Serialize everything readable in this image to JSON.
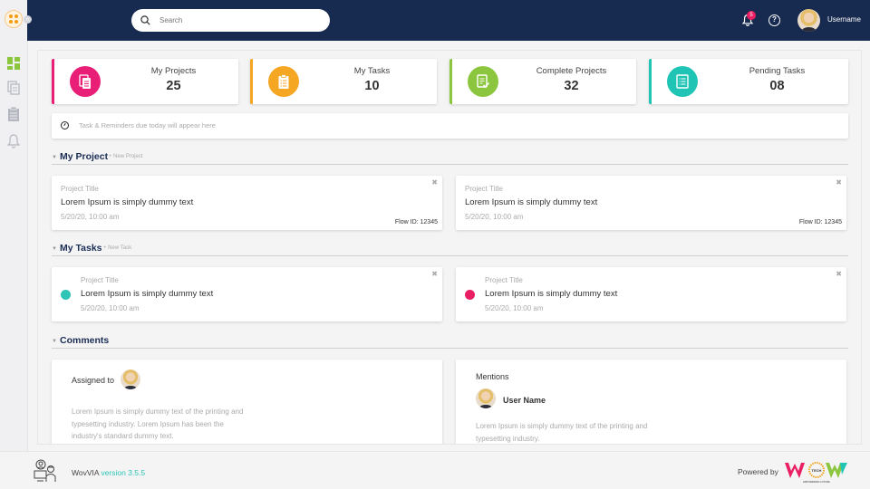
{
  "header": {
    "search_placeholder": "Search",
    "notification_count": "5",
    "help_glyph": "?",
    "username": "Username"
  },
  "sidebar": {
    "collapse_glyph": "«",
    "items": [
      {
        "name": "dashboard",
        "icon": "grid-icon",
        "active": true
      },
      {
        "name": "projects",
        "icon": "documents-icon"
      },
      {
        "name": "tasks",
        "icon": "clipboard-icon"
      },
      {
        "name": "notifications",
        "icon": "bell-icon"
      }
    ]
  },
  "stats": [
    {
      "label": "My Projects",
      "value": "25",
      "color": "#e91e76",
      "icon": "documents-icon"
    },
    {
      "label": "My Tasks",
      "value": "10",
      "color": "#f5a623",
      "icon": "clipboard-list-icon"
    },
    {
      "label": "Complete Projects",
      "value": "32",
      "color": "#8cc63f",
      "icon": "document-check-icon"
    },
    {
      "label": "Pending Tasks",
      "value": "08",
      "color": "#20c4b4",
      "icon": "list-icon"
    }
  ],
  "reminder": {
    "text": "Task & Reminders due today will appear here"
  },
  "sections": {
    "project": {
      "title": "My Project",
      "add": "+ New Project"
    },
    "tasks": {
      "title": "My Tasks",
      "add": "+ New Task"
    },
    "comments": {
      "title": "Comments"
    }
  },
  "projects": [
    {
      "title_label": "Project Title",
      "text": "Lorem Ipsum is simply dummy text",
      "date": "5/20/20, 10:00 am",
      "flow": "Flow ID: 12345"
    },
    {
      "title_label": "Project Title",
      "text": "Lorem Ipsum is simply dummy text",
      "date": "5/20/20, 10:00 am",
      "flow": "Flow ID: 12345"
    }
  ],
  "tasks": [
    {
      "title_label": "Project Title",
      "text": "Lorem Ipsum is simply dummy text",
      "date": "5/20/20, 10:00 am",
      "status_color": "#2ec4b6"
    },
    {
      "title_label": "Project Title",
      "text": "Lorem Ipsum is simply dummy text",
      "date": "5/20/20, 10:00 am",
      "status_color": "#e91e63"
    }
  ],
  "close_glyph": "✖",
  "comments": {
    "assigned": {
      "label": "Assigned to",
      "body": "Lorem Ipsum is simply dummy text of the printing and typesetting industry. Lorem Ipsum has been the industry's standard dummy text."
    },
    "mentions": {
      "label": "Mentions",
      "user": "User Name",
      "body": "Lorem Ipsum is simply dummy text of the printing and typesetting industry."
    }
  },
  "footer": {
    "app_name": "WovVIA",
    "version": "version 3.5.5",
    "powered_by": "Powered by",
    "brand_tagline": "EMPOWERING FUTURE"
  }
}
